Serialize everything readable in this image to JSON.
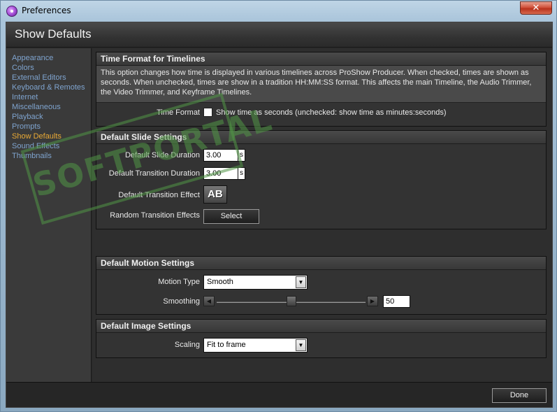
{
  "window": {
    "title": "Preferences",
    "close_glyph": "✕"
  },
  "header": {
    "title": "Show Defaults"
  },
  "sidebar": {
    "items": [
      {
        "label": "Appearance"
      },
      {
        "label": "Colors"
      },
      {
        "label": "External Editors"
      },
      {
        "label": "Keyboard & Remotes"
      },
      {
        "label": "Internet"
      },
      {
        "label": "Miscellaneous"
      },
      {
        "label": "Playback"
      },
      {
        "label": "Prompts"
      },
      {
        "label": "Show Defaults",
        "active": true
      },
      {
        "label": "Sound Effects"
      },
      {
        "label": "Thumbnails"
      }
    ]
  },
  "time_format": {
    "title": "Time Format for Timelines",
    "description": "This option changes how time is displayed in various timelines across ProShow Producer. When checked, times are shown as seconds. When unchecked, times are show in a tradition HH:MM:SS format. This affects the main Timeline, the Audio Trimmer, the Video Trimmer, and Keyframe Timelines.",
    "label": "Time Format",
    "checkbox_label": "Show time as seconds (unchecked: show time as minutes:seconds)",
    "checked": false
  },
  "slide_settings": {
    "title": "Default Slide Settings",
    "slide_duration_label": "Default Slide Duration",
    "slide_duration_value": "3.00",
    "slide_duration_unit": "s",
    "transition_duration_label": "Default Transition Duration",
    "transition_duration_value": "3.00",
    "transition_duration_unit": "s",
    "transition_effect_label": "Default Transition Effect",
    "transition_effect_glyph": "AB",
    "random_effects_label": "Random Transition Effects",
    "select_button": "Select"
  },
  "motion_settings": {
    "title": "Default Motion Settings",
    "motion_type_label": "Motion Type",
    "motion_type_value": "Smooth",
    "smoothing_label": "Smoothing",
    "smoothing_value": "50",
    "smoothing_fraction": 0.5
  },
  "image_settings": {
    "title": "Default Image Settings",
    "scaling_label": "Scaling",
    "scaling_value": "Fit to frame"
  },
  "footer": {
    "done_button": "Done"
  },
  "watermark": {
    "text": "SOFTPORTAL"
  },
  "icons": {
    "dropdown": "▼",
    "slider_left": "◀",
    "slider_right": "▶"
  }
}
